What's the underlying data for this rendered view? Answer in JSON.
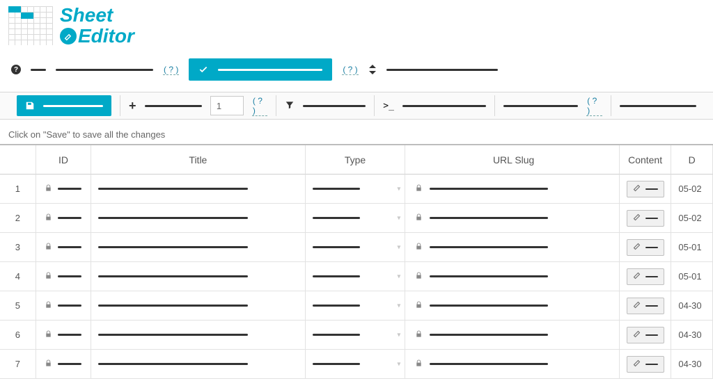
{
  "brand": {
    "line1": "Sheet",
    "line2": "Editor"
  },
  "optbar": {
    "help1": "( ? )",
    "help2": "( ? )"
  },
  "toolbar": {
    "page_value": "1",
    "qmark1": "( ? )",
    "qmark2": "( ? )",
    "prompt": ">_"
  },
  "hint": "Click on \"Save\" to save all the changes",
  "columns": {
    "id": "ID",
    "title": "Title",
    "type": "Type",
    "slug": "URL Slug",
    "content": "Content",
    "date": "D"
  },
  "rows": [
    {
      "n": "1",
      "date": "05-02"
    },
    {
      "n": "2",
      "date": "05-02"
    },
    {
      "n": "3",
      "date": "05-01"
    },
    {
      "n": "4",
      "date": "05-01"
    },
    {
      "n": "5",
      "date": "04-30"
    },
    {
      "n": "6",
      "date": "04-30"
    },
    {
      "n": "7",
      "date": "04-30"
    }
  ]
}
